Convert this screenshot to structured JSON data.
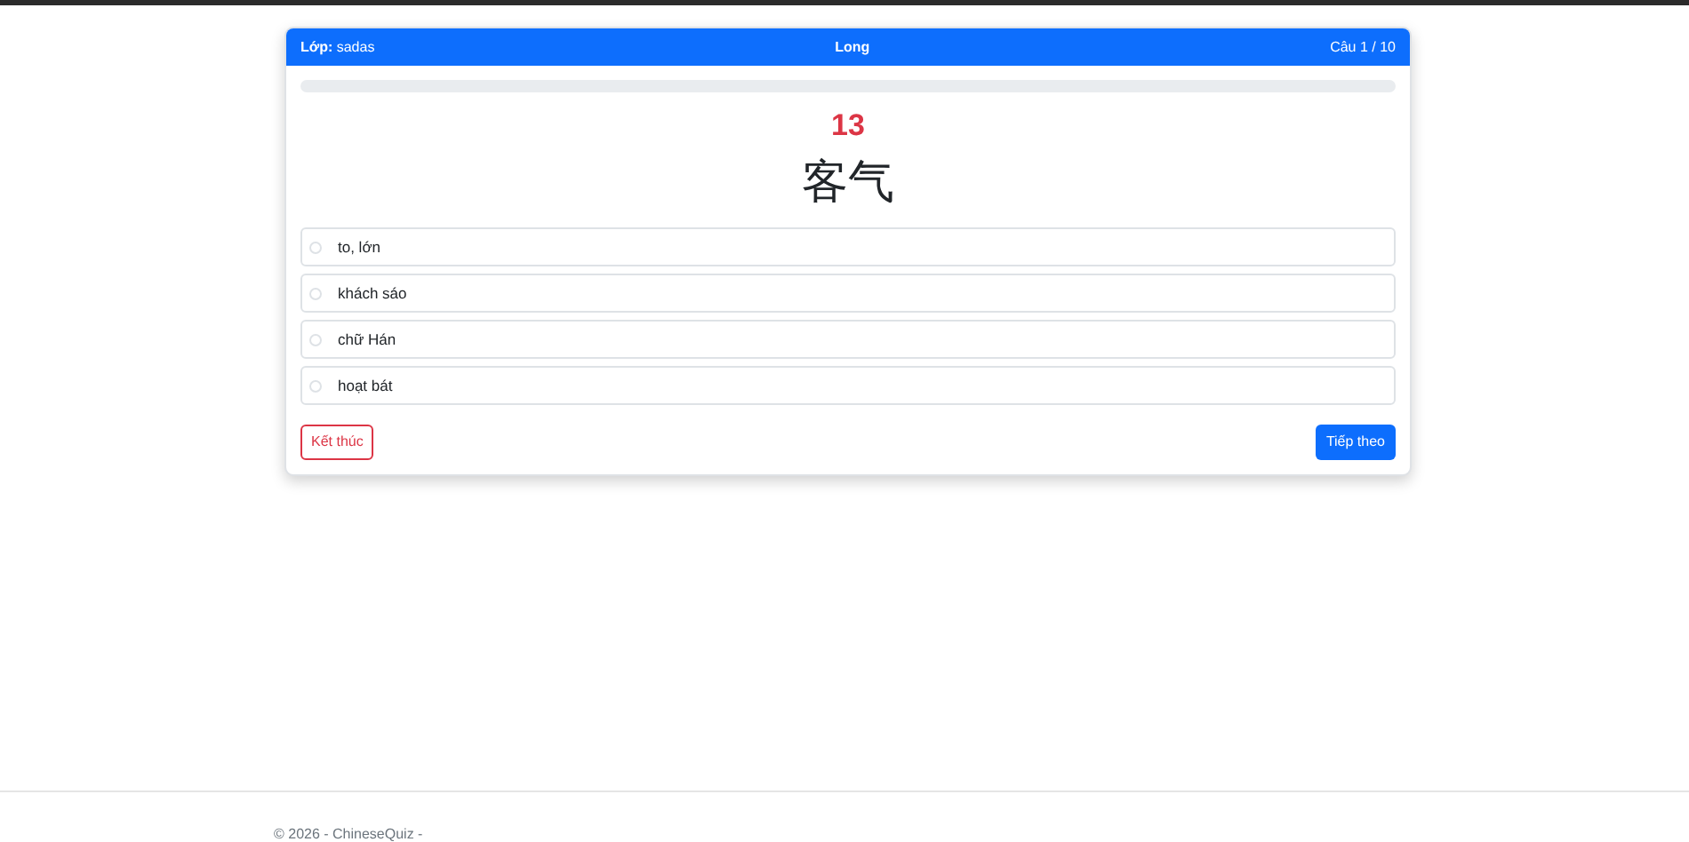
{
  "header": {
    "class_label": "Lớp:",
    "class_value": "sadas",
    "student": "Long",
    "question_counter": "Câu 1 / 10"
  },
  "progress": {
    "level": 0
  },
  "question": {
    "number": "13",
    "word": "客气"
  },
  "options": [
    {
      "label": "to, lớn",
      "selected": false
    },
    {
      "label": "khách sáo",
      "selected": false
    },
    {
      "label": "chữ Hán",
      "selected": false
    },
    {
      "label": "hoạt bát",
      "selected": false
    }
  ],
  "buttons": {
    "finish": "Kết thúc",
    "next": "Tiếp theo"
  },
  "footer": {
    "text": "© 2026 - ChineseQuiz -"
  }
}
